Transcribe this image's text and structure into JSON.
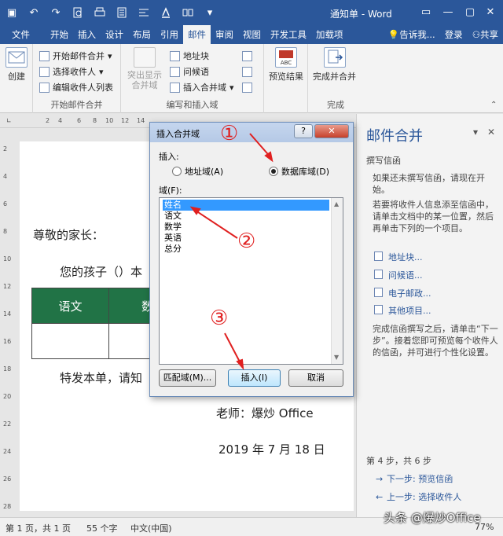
{
  "titlebar": {
    "title": "通知单 - Word",
    "qa_icons": [
      "save-icon",
      "undo-icon",
      "redo-icon",
      "print-preview-icon",
      "print-icon",
      "format-icon",
      "align-icon",
      "font-color-icon",
      "mail-merge-icon",
      "more-icon"
    ],
    "undo_glyph": "↶",
    "redo_glyph": "↷",
    "save_glyph": "▣",
    "more_glyph": "▾",
    "window_buttons": [
      "▭",
      "—",
      "▢",
      "✕"
    ]
  },
  "tabs": [
    "文件",
    "开始",
    "插入",
    "设计",
    "布局",
    "引用",
    "邮件",
    "审阅",
    "视图",
    "开发工具",
    "加载项"
  ],
  "active_tab": "邮件",
  "tabs_right": {
    "tell_me": "告诉我...",
    "signin": "登录",
    "share": "共享"
  },
  "ribbon": {
    "create": {
      "label": "创建"
    },
    "start_merge": {
      "items": [
        "开始邮件合并",
        "选择收件人",
        "编辑收件人列表"
      ],
      "group_label": "开始邮件合并"
    },
    "write_insert": {
      "highlight": "突出显示合并域",
      "items": [
        "地址块",
        "问候语",
        "插入合并域"
      ],
      "group_label": "编写和插入域"
    },
    "preview": {
      "label": "预览结果"
    },
    "finish": {
      "label": "完成并合并",
      "group_label": "完成"
    }
  },
  "ruler": {
    "ticks": [
      "2",
      "4",
      "6",
      "8",
      "10",
      "12",
      "14"
    ],
    "vticks": [
      "2",
      "4",
      "6",
      "8",
      "10",
      "12",
      "14",
      "16",
      "18",
      "20",
      "22",
      "24",
      "26",
      "28"
    ]
  },
  "document": {
    "greeting": "尊敬的家长：",
    "line1_a": "您的孩子（",
    "line1_b": "）本",
    "table_head": [
      "语文",
      "数"
    ],
    "line2": "特发本单，请知",
    "teacher": "老师：爆炒 Office",
    "date": "2019 年 7 月 18 日"
  },
  "dialog": {
    "title": "插入合并域",
    "help": "?",
    "close": "✕",
    "insert_label": "插入:",
    "radio_address": "地址域(A)",
    "radio_db": "数据库域(D)",
    "radio_selected": "db",
    "fields_label": "域(F):",
    "fields": [
      "姓名",
      "语文",
      "数学",
      "英语",
      "总分"
    ],
    "selected_field": "姓名",
    "btn_match": "匹配域(M)...",
    "btn_insert": "插入(I)",
    "btn_cancel": "取消"
  },
  "annotations": [
    "①",
    "②",
    "③"
  ],
  "pane": {
    "title": "邮件合并",
    "pin": "▾",
    "close": "✕",
    "section": "撰写信函",
    "para1": "如果还未撰写信函，请现在开始。",
    "para2": "若要将收件人信息添至信函中，请单击文档中的某一位置，然后再单击下列的一个项目。",
    "links": [
      "地址块...",
      "问候语...",
      "电子邮政...",
      "其他项目..."
    ],
    "para3": "完成信函撰写之后，请单击“下一步”。接着您即可预览每个收件人的信函，并可进行个性化设置。",
    "step": "第 4 步，共 6 步",
    "next": "下一步: 预览信函",
    "prev": "上一步: 选择收件人"
  },
  "status": {
    "page": "第 1 页，共 1 页",
    "words": "55 个字",
    "lang": "中文(中国)",
    "zoom": "77%"
  },
  "watermark": "头条 @爆炒Office",
  "colors": {
    "accent": "#2b579a",
    "table_head": "#217346",
    "annotation": "#e02020"
  }
}
